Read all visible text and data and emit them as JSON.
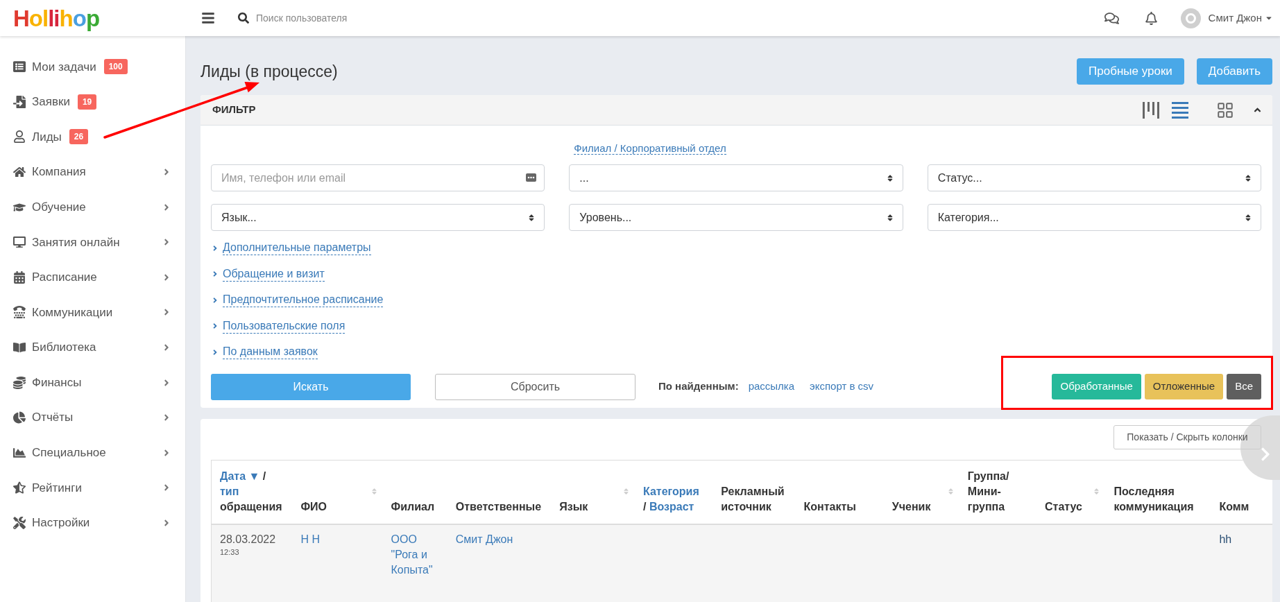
{
  "topbar": {
    "logo": "Hollihop",
    "search": {
      "placeholder": "Поиск пользователя"
    },
    "user": {
      "name": "Смит Джон"
    }
  },
  "sidebar": {
    "items": [
      {
        "label": "Мои задачи",
        "badge": "100",
        "expandable": false
      },
      {
        "label": "Заявки",
        "badge": "19",
        "expandable": false
      },
      {
        "label": "Лиды",
        "badge": "26",
        "expandable": false
      },
      {
        "label": "Компания",
        "expandable": true
      },
      {
        "label": "Обучение",
        "expandable": true
      },
      {
        "label": "Занятия онлайн",
        "expandable": true
      },
      {
        "label": "Расписание",
        "expandable": true
      },
      {
        "label": "Коммуникации",
        "expandable": true
      },
      {
        "label": "Библиотека",
        "expandable": true
      },
      {
        "label": "Финансы",
        "expandable": true
      },
      {
        "label": "Отчёты",
        "expandable": true
      },
      {
        "label": "Специальное",
        "expandable": true
      },
      {
        "label": "Рейтинги",
        "expandable": true
      },
      {
        "label": "Настройки",
        "expandable": true
      }
    ]
  },
  "page": {
    "title": "Лиды (в процессе)",
    "buttons": [
      "Пробные уроки",
      "Добавить"
    ]
  },
  "filter": {
    "title": "ФИЛЬТР",
    "view_modes": [
      {
        "kind": "columns",
        "selected": false
      },
      {
        "kind": "list",
        "selected": true
      },
      {
        "kind": "grid",
        "selected": false
      }
    ],
    "expanded": true,
    "branch_link": "Филиал / Корпоративный отдел",
    "fields": [
      {
        "kind": "text",
        "placeholder": "Имя, телефон или email"
      },
      {
        "kind": "select",
        "value": "..."
      },
      {
        "kind": "select",
        "value": "Статус..."
      },
      {
        "kind": "select",
        "value": "Язык..."
      },
      {
        "kind": "select",
        "value": "Уровень..."
      },
      {
        "kind": "select",
        "value": "Категория..."
      }
    ],
    "sections": [
      {
        "label": "Дополнительные параметры",
        "expanded": false
      },
      {
        "label": "Обращение и визит",
        "expanded": false
      },
      {
        "label": "Предпочтительное расписание",
        "expanded": false
      },
      {
        "label": "Пользовательские поля",
        "expanded": false
      },
      {
        "label": "По данным заявок",
        "expanded": false
      }
    ],
    "search_button": "Искать",
    "reset_button": "Сбросить",
    "found_label": "По найденным:",
    "found_links": [
      "рассылка",
      "экспорт в csv"
    ],
    "status_filters": [
      {
        "label": "Обработанные",
        "color": "#26b99a"
      },
      {
        "label": "Отложенные",
        "color": "#e8c25a"
      },
      {
        "label": "Все",
        "color": "#5f5f5f"
      }
    ]
  },
  "table": {
    "columns_toggle": "Показать / Скрыть колонки",
    "columns": [
      {
        "lines": [
          [
            {
              "text": "Дата ▼",
              "link": true
            },
            {
              "text": "/",
              "link": false
            }
          ],
          [
            {
              "text": "тип",
              "link": true
            }
          ],
          [
            {
              "text": "обращения",
              "link": false
            }
          ]
        ],
        "sortable": false
      },
      {
        "lines": [
          [
            {
              "text": "ФИО",
              "link": false
            }
          ]
        ],
        "sortable": true
      },
      {
        "lines": [
          [
            {
              "text": "Филиал",
              "link": false
            }
          ]
        ],
        "sortable": false
      },
      {
        "lines": [
          [
            {
              "text": "Ответственные",
              "link": false
            }
          ]
        ],
        "sortable": false
      },
      {
        "lines": [
          [
            {
              "text": "Язык",
              "link": false
            }
          ]
        ],
        "sortable": true
      },
      {
        "lines": [
          [
            {
              "text": "Категория",
              "link": true
            }
          ],
          [
            {
              "text": "/",
              "link": false
            },
            {
              "text": "Возраст",
              "link": true
            }
          ]
        ],
        "sortable": false
      },
      {
        "lines": [
          [
            {
              "text": "Рекламный источник",
              "link": false
            }
          ]
        ],
        "sortable": false
      },
      {
        "lines": [
          [
            {
              "text": "Контакты",
              "link": false
            }
          ]
        ],
        "sortable": false
      },
      {
        "lines": [
          [
            {
              "text": "Ученик",
              "link": false
            }
          ]
        ],
        "sortable": true
      },
      {
        "lines": [
          [
            {
              "text": "Группа/ Мини-группа",
              "link": false
            }
          ]
        ],
        "sortable": false
      },
      {
        "lines": [
          [
            {
              "text": "Статус",
              "link": false
            }
          ]
        ],
        "sortable": true
      },
      {
        "lines": [
          [
            {
              "text": "Последняя коммуникация",
              "link": false
            }
          ]
        ],
        "sortable": false
      },
      {
        "lines": [
          [
            {
              "text": "Комм",
              "link": false
            }
          ]
        ],
        "sortable": false
      }
    ],
    "rows": [
      {
        "cells": [
          {
            "kind": "datetime",
            "text": "28.03.2022",
            "sub": "12:33"
          },
          {
            "kind": "link",
            "text": "Н Н"
          },
          {
            "kind": "link",
            "text": "ООО \"Рога и Копыта\""
          },
          {
            "kind": "link",
            "text": "Смит Джон"
          },
          {
            "kind": "empty"
          },
          {
            "kind": "empty"
          },
          {
            "kind": "empty"
          },
          {
            "kind": "empty"
          },
          {
            "kind": "empty"
          },
          {
            "kind": "empty"
          },
          {
            "kind": "empty"
          },
          {
            "kind": "empty"
          },
          {
            "kind": "text",
            "text": "hh"
          }
        ]
      }
    ]
  },
  "annotations": {
    "arrow": true,
    "highlight_frame": true
  }
}
